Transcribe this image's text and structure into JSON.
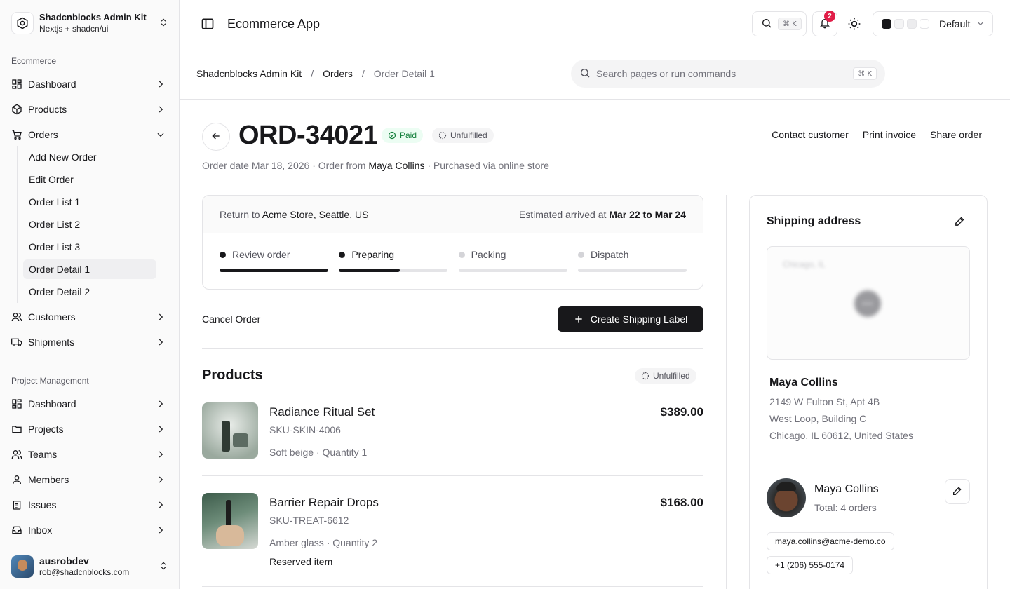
{
  "sidebar": {
    "brand_title": "Shadcnblocks Admin Kit",
    "brand_sub": "Nextjs + shadcn/ui",
    "group1_label": "Ecommerce",
    "group2_label": "Project Management",
    "ecommerce": [
      {
        "label": "Dashboard",
        "icon": "dashboard-icon"
      },
      {
        "label": "Products",
        "icon": "box-icon"
      },
      {
        "label": "Orders",
        "icon": "cart-icon"
      },
      {
        "label": "Customers",
        "icon": "users-icon"
      },
      {
        "label": "Shipments",
        "icon": "truck-icon"
      }
    ],
    "orders_sub": [
      "Add New Order",
      "Edit Order",
      "Order List 1",
      "Order List 2",
      "Order List 3",
      "Order Detail 1",
      "Order Detail 2"
    ],
    "project": [
      {
        "label": "Dashboard",
        "icon": "dashboard-icon"
      },
      {
        "label": "Projects",
        "icon": "folder-icon"
      },
      {
        "label": "Teams",
        "icon": "users-icon"
      },
      {
        "label": "Members",
        "icon": "user-icon"
      },
      {
        "label": "Issues",
        "icon": "clipboard-icon"
      },
      {
        "label": "Inbox",
        "icon": "inbox-icon"
      }
    ],
    "user_name": "ausrobdev",
    "user_email": "rob@shadcnblocks.com"
  },
  "topbar": {
    "title": "Ecommerce App",
    "kbd": "⌘ K",
    "notif_count": "2",
    "theme_label": "Default"
  },
  "breadcrumb": {
    "root": "Shadcnblocks Admin Kit",
    "orders": "Orders",
    "current": "Order Detail 1",
    "sep": "/"
  },
  "command": {
    "placeholder": "Search pages or run commands",
    "kbd": "⌘ K"
  },
  "order": {
    "id": "ORD-34021",
    "paid_label": "Paid",
    "fulfillment_label": "Unfulfilled",
    "meta_prefix": "Order date Mar 18, 2026 · Order from ",
    "customer": "Maya Collins",
    "meta_suffix": " · Purchased via online store",
    "actions": [
      "Contact customer",
      "Print invoice",
      "Share order"
    ]
  },
  "tracking": {
    "return_prefix": "Return to ",
    "return_to": "Acme Store, Seattle, US",
    "eta_prefix": "Estimated arrived at ",
    "eta": "Mar 22 to Mar 24",
    "steps": [
      {
        "label": "Review order",
        "progress": 1.0,
        "state": "done"
      },
      {
        "label": "Preparing",
        "progress": 0.56,
        "state": "active"
      },
      {
        "label": "Packing",
        "progress": 0,
        "state": "pending"
      },
      {
        "label": "Dispatch",
        "progress": 0,
        "state": "pending"
      }
    ]
  },
  "actions": {
    "cancel": "Cancel Order",
    "create_label": "Create Shipping Label"
  },
  "products": {
    "title": "Products",
    "status": "Unfulfilled",
    "items": [
      {
        "name": "Radiance Ritual Set",
        "sku": "SKU-SKIN-4006",
        "variant": "Soft beige · Quantity 1",
        "price": "$389.00",
        "note": ""
      },
      {
        "name": "Barrier Repair Drops",
        "sku": "SKU-TREAT-6612",
        "variant": "Amber glass · Quantity 2",
        "price": "$168.00",
        "note": "Reserved item"
      }
    ]
  },
  "shipping": {
    "title": "Shipping address",
    "map_city": "Chicago, IL",
    "name": "Maya Collins",
    "lines": [
      "2149 W Fulton St, Apt 4B",
      "West Loop, Building C",
      "Chicago, IL 60612, United States"
    ]
  },
  "customer": {
    "name": "Maya Collins",
    "total": "Total: 4 orders",
    "email": "maya.collins@acme-demo.co",
    "phone": "+1 (206) 555-0174"
  },
  "colors": {
    "accent": "#18181b",
    "paid": "#15803d",
    "badge": "#e11d48",
    "border": "#e4e4e7"
  }
}
